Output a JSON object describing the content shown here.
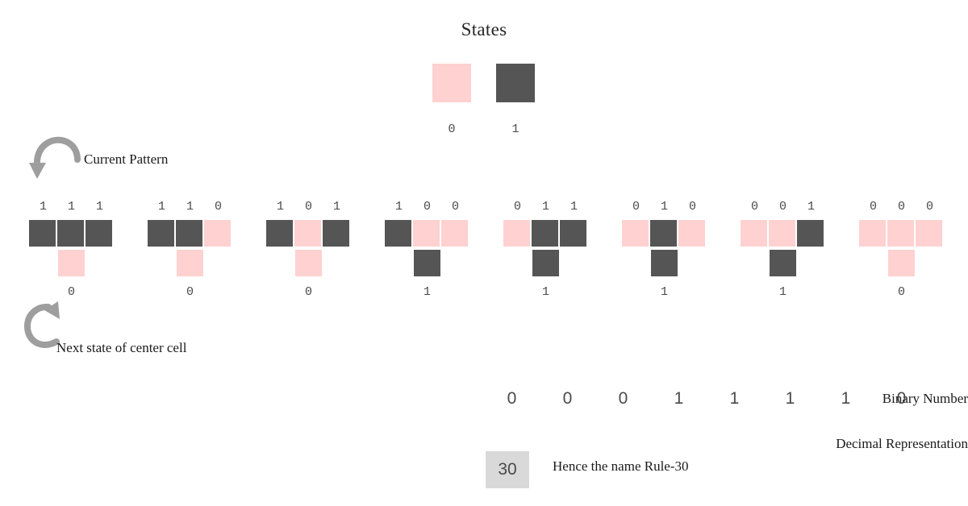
{
  "title": "States",
  "colors": {
    "state_off": "#ffd1d1",
    "state_on": "#555555",
    "arrow": "#9e9e9e",
    "decimal_box_bg": "#d9d9d9",
    "background": "#ffffff",
    "text": "#4a4a4a"
  },
  "states_legend": [
    {
      "label": "0",
      "color": "#ffd1d1",
      "state": 0
    },
    {
      "label": "1",
      "color": "#555555",
      "state": 1
    }
  ],
  "annotations": {
    "current_pattern": "Current Pattern",
    "next_state": "Next state of center cell"
  },
  "rules": [
    {
      "pattern": [
        "1",
        "1",
        "1"
      ],
      "cells": [
        1,
        1,
        1
      ],
      "result": "0",
      "result_cell": 0
    },
    {
      "pattern": [
        "1",
        "1",
        "0"
      ],
      "cells": [
        1,
        1,
        0
      ],
      "result": "0",
      "result_cell": 0
    },
    {
      "pattern": [
        "1",
        "0",
        "1"
      ],
      "cells": [
        1,
        0,
        1
      ],
      "result": "0",
      "result_cell": 0
    },
    {
      "pattern": [
        "1",
        "0",
        "0"
      ],
      "cells": [
        1,
        0,
        0
      ],
      "result": "1",
      "result_cell": 1
    },
    {
      "pattern": [
        "0",
        "1",
        "1"
      ],
      "cells": [
        0,
        1,
        1
      ],
      "result": "1",
      "result_cell": 1
    },
    {
      "pattern": [
        "0",
        "1",
        "0"
      ],
      "cells": [
        0,
        1,
        0
      ],
      "result": "1",
      "result_cell": 1
    },
    {
      "pattern": [
        "0",
        "0",
        "1"
      ],
      "cells": [
        0,
        0,
        1
      ],
      "result": "1",
      "result_cell": 1
    },
    {
      "pattern": [
        "0",
        "0",
        "0"
      ],
      "cells": [
        0,
        0,
        0
      ],
      "result": "0",
      "result_cell": 0
    }
  ],
  "summary": {
    "binary_label": "Binary Number",
    "binary_digits": [
      "0",
      "0",
      "0",
      "1",
      "1",
      "1",
      "1",
      "0"
    ],
    "decimal_label": "Decimal Representation",
    "decimal_value": "30",
    "decimal_note": "Hence the name Rule-30"
  }
}
